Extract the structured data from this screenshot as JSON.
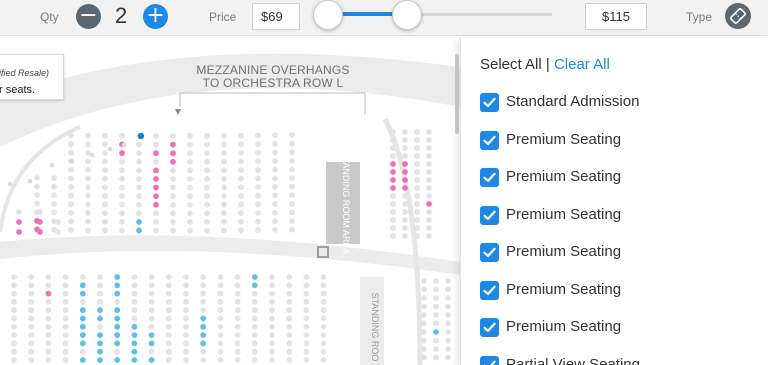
{
  "filters": {
    "qty_label": "Qty",
    "qty_value": "2",
    "minus_label": "−",
    "plus_label": "+",
    "price_label": "Price",
    "price_min": "$69",
    "price_max": "$115",
    "type_label": "Type",
    "type_icon": "ticket-icon"
  },
  "map": {
    "tooltip_line1": "ified Resale)",
    "tooltip_line2": "r seats.",
    "overhang_line1": "MEZZANINE OVERHANGS",
    "overhang_line2": "TO ORCHESTRA ROW L",
    "standing_area_label": "STANDING ROOM AREA",
    "standing_room_label": "STANDING ROO",
    "colors": {
      "seat_available": "#e3e3e3",
      "seat_pink": "#f06fb6",
      "seat_blue": "#5bc0eb",
      "seat_dark_blue": "#1a7fd6",
      "section_gray": "#ececec"
    }
  },
  "type_panel": {
    "select_all": "Select All",
    "separator": "|",
    "clear_all": "Clear All",
    "options": [
      {
        "label": "Standard Admission",
        "checked": true
      },
      {
        "label": "Premium Seating",
        "checked": true
      },
      {
        "label": "Premium Seating",
        "checked": true
      },
      {
        "label": "Premium Seating",
        "checked": true
      },
      {
        "label": "Premium Seating",
        "checked": true
      },
      {
        "label": "Premium Seating",
        "checked": true
      },
      {
        "label": "Premium Seating",
        "checked": true
      },
      {
        "label": "Partial View Seating",
        "checked": true
      }
    ],
    "accent": "#1e88e5"
  }
}
